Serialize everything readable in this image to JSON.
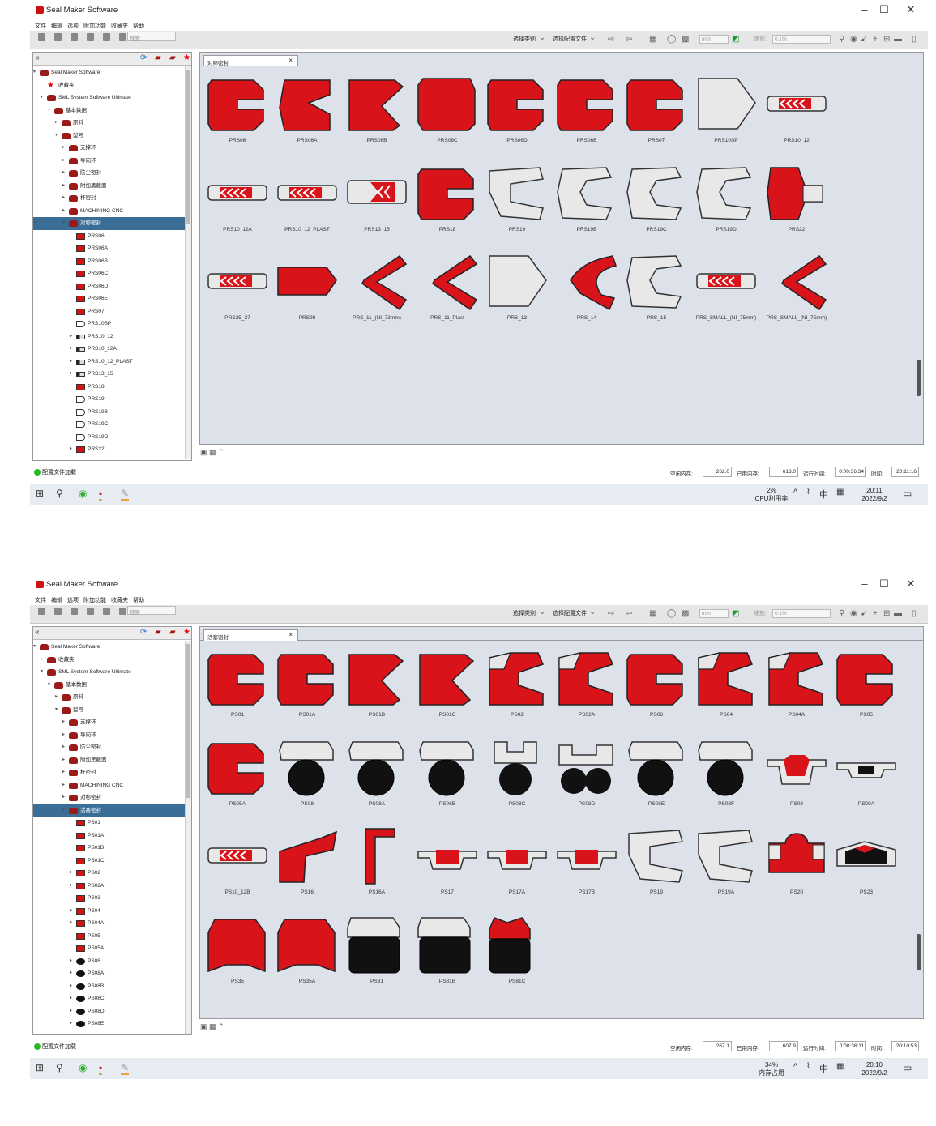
{
  "shots": [
    {
      "window_title": "Seal Maker Software",
      "menu": [
        "文件",
        "编辑",
        "选项",
        "附加功能",
        "收藏夹",
        "帮助"
      ],
      "toolbar": {
        "category_select": "选择类别",
        "config_select": "选择配置文件",
        "unit_value": "mm",
        "zoom_label": "缩放:",
        "zoom_value": "0.1%",
        "search_placeholder": "搜索"
      },
      "tab_label": "对称密封",
      "tree": [
        {
          "label": "Seal Maker Software",
          "level": 0,
          "icon": "folder",
          "exp": "▾"
        },
        {
          "label": "收藏夹",
          "level": 1,
          "icon": "star",
          "exp": ""
        },
        {
          "label": "SML System Software Ultimate",
          "level": 1,
          "icon": "folder",
          "exp": "▾"
        },
        {
          "label": "基本数据",
          "level": 2,
          "icon": "folder",
          "exp": "▾"
        },
        {
          "label": "原料",
          "level": 3,
          "icon": "folder",
          "exp": "▸"
        },
        {
          "label": "型号",
          "level": 3,
          "icon": "folder",
          "exp": "▾"
        },
        {
          "label": "支撑环",
          "level": 4,
          "icon": "folder",
          "exp": "▸"
        },
        {
          "label": "导向环",
          "level": 4,
          "icon": "folder",
          "exp": "▸"
        },
        {
          "label": "防尘密封",
          "level": 4,
          "icon": "folder",
          "exp": "▸"
        },
        {
          "label": "附加黑截面",
          "level": 4,
          "icon": "folder",
          "exp": "▸"
        },
        {
          "label": "杆密封",
          "level": 4,
          "icon": "folder",
          "exp": "▸"
        },
        {
          "label": "MACHINING CNC",
          "level": 4,
          "icon": "folder",
          "exp": "▸"
        },
        {
          "label": "对称密封",
          "level": 4,
          "icon": "folder",
          "exp": "▾",
          "selected": true
        },
        {
          "label": "PRS06",
          "level": 5,
          "icon": "red",
          "exp": ""
        },
        {
          "label": "PRS06A",
          "level": 5,
          "icon": "red",
          "exp": ""
        },
        {
          "label": "PRS06B",
          "level": 5,
          "icon": "red",
          "exp": ""
        },
        {
          "label": "PRS06C",
          "level": 5,
          "icon": "red",
          "exp": ""
        },
        {
          "label": "PRS06D",
          "level": 5,
          "icon": "red",
          "exp": ""
        },
        {
          "label": "PRS06E",
          "level": 5,
          "icon": "red",
          "exp": ""
        },
        {
          "label": "PRS07",
          "level": 5,
          "icon": "red",
          "exp": ""
        },
        {
          "label": "PRS10SP",
          "level": 5,
          "icon": "white",
          "exp": ""
        },
        {
          "label": "PRS10_12",
          "level": 5,
          "icon": "bar",
          "exp": "▸"
        },
        {
          "label": "PRS10_12A",
          "level": 5,
          "icon": "bar",
          "exp": "▸"
        },
        {
          "label": "PRS10_12_PLAST",
          "level": 5,
          "icon": "bar",
          "exp": "▸"
        },
        {
          "label": "PRS13_15",
          "level": 5,
          "icon": "bar",
          "exp": "▸"
        },
        {
          "label": "PRS18",
          "level": 5,
          "icon": "red",
          "exp": ""
        },
        {
          "label": "PRS19",
          "level": 5,
          "icon": "white",
          "exp": ""
        },
        {
          "label": "PRS19B",
          "level": 5,
          "icon": "white",
          "exp": ""
        },
        {
          "label": "PRS19C",
          "level": 5,
          "icon": "white",
          "exp": ""
        },
        {
          "label": "PRS19D",
          "level": 5,
          "icon": "white",
          "exp": ""
        },
        {
          "label": "PRS22",
          "level": 5,
          "icon": "red",
          "exp": "▸"
        },
        {
          "label": "PRS25_27",
          "level": 5,
          "icon": "bar",
          "exp": "▸"
        },
        {
          "label": "PRS99",
          "level": 5,
          "icon": "red",
          "exp": ""
        }
      ],
      "items": [
        {
          "label": "PRS06",
          "shape": "c-red"
        },
        {
          "label": "PRS06A",
          "shape": "c-thin"
        },
        {
          "label": "PRS06B",
          "shape": "k-red"
        },
        {
          "label": "PRS06C",
          "shape": "block-red"
        },
        {
          "label": "PRS06D",
          "shape": "c-red"
        },
        {
          "label": "PRS06E",
          "shape": "c-red"
        },
        {
          "label": "PRS07",
          "shape": "c-red"
        },
        {
          "label": "PRS10SP",
          "shape": "pent-white"
        },
        {
          "label": "PRS10_12",
          "shape": "bar"
        },
        {
          "label": "PRS10_12A",
          "shape": "bar"
        },
        {
          "label": "PRS10_12_PLAST",
          "shape": "bar"
        },
        {
          "label": "PRS13_15",
          "shape": "bar-half"
        },
        {
          "label": "PRS18",
          "shape": "c-red"
        },
        {
          "label": "PRS19",
          "shape": "u-white"
        },
        {
          "label": "PRS19B",
          "shape": "c-white"
        },
        {
          "label": "PRS19C",
          "shape": "c-white"
        },
        {
          "label": "PRS19D",
          "shape": "c-white"
        },
        {
          "label": "PRS22",
          "shape": "red-plug"
        },
        {
          "label": "PRS25_27",
          "shape": "bar"
        },
        {
          "label": "PRS99",
          "shape": "flat-red"
        },
        {
          "label": "PRS_11_(NI_73mm)",
          "shape": "v-red"
        },
        {
          "label": "PRS_11_Plast",
          "shape": "v-red"
        },
        {
          "label": "PRS_13",
          "shape": "pent-white"
        },
        {
          "label": "PRS_14",
          "shape": "horn-red"
        },
        {
          "label": "PRS_15",
          "shape": "c-white"
        },
        {
          "label": "PRS_SMALL_(NI_75mm)",
          "shape": "bar"
        },
        {
          "label": "PRS_SMALL_(NI_75mm)",
          "shape": "v-red"
        }
      ],
      "cols": 9,
      "status": {
        "text": "配置文件加载",
        "free_mem_label": "空闲内存:",
        "free_mem": "262.0",
        "used_mem_label": "已用内存:",
        "used_mem": "613.0",
        "runtime_label": "运行时间:",
        "runtime": "0:00:36:34",
        "time_label": "时间:",
        "time": "20:11:16"
      },
      "taskbar": {
        "perf_value": "2%",
        "perf_label": "CPU利用率",
        "ime": "中",
        "clock_time": "20:11",
        "clock_date": "2022/9/2"
      },
      "tree_thumb_top": 0.0,
      "canvas_thumb_top": 0.78
    },
    {
      "window_title": "Seal Maker Software",
      "menu": [
        "文件",
        "编辑",
        "选项",
        "附加功能",
        "收藏夹",
        "帮助"
      ],
      "toolbar": {
        "category_select": "选择类别",
        "config_select": "选择配置文件",
        "unit_value": "mm",
        "zoom_label": "缩放:",
        "zoom_value": "0.1%",
        "search_placeholder": "搜索"
      },
      "tab_label": "活塞密封",
      "tree": [
        {
          "label": "Seal Maker Software",
          "level": 0,
          "icon": "folder",
          "exp": "▾"
        },
        {
          "label": "收藏夹",
          "level": 1,
          "icon": "folder",
          "exp": "▸"
        },
        {
          "label": "SML System Software Ultimate",
          "level": 1,
          "icon": "folder",
          "exp": "▾"
        },
        {
          "label": "基本数据",
          "level": 2,
          "icon": "folder",
          "exp": "▾"
        },
        {
          "label": "原料",
          "level": 3,
          "icon": "folder",
          "exp": "▸"
        },
        {
          "label": "型号",
          "level": 3,
          "icon": "folder",
          "exp": "▾"
        },
        {
          "label": "支撑环",
          "level": 4,
          "icon": "folder",
          "exp": "▸"
        },
        {
          "label": "导向环",
          "level": 4,
          "icon": "folder",
          "exp": "▸"
        },
        {
          "label": "防尘密封",
          "level": 4,
          "icon": "folder",
          "exp": "▸"
        },
        {
          "label": "附加黑截面",
          "level": 4,
          "icon": "folder",
          "exp": "▸"
        },
        {
          "label": "杆密封",
          "level": 4,
          "icon": "folder",
          "exp": "▸"
        },
        {
          "label": "MACHINING CNC",
          "level": 4,
          "icon": "folder",
          "exp": "▸"
        },
        {
          "label": "对称密封",
          "level": 4,
          "icon": "folder",
          "exp": "▸"
        },
        {
          "label": "活塞密封",
          "level": 4,
          "icon": "folder",
          "exp": "▾",
          "selected": true
        },
        {
          "label": "PS01",
          "level": 5,
          "icon": "red",
          "exp": ""
        },
        {
          "label": "PS01A",
          "level": 5,
          "icon": "red",
          "exp": ""
        },
        {
          "label": "PS01B",
          "level": 5,
          "icon": "red",
          "exp": ""
        },
        {
          "label": "PS01C",
          "level": 5,
          "icon": "red",
          "exp": ""
        },
        {
          "label": "PS02",
          "level": 5,
          "icon": "red",
          "exp": "▸"
        },
        {
          "label": "PS02A",
          "level": 5,
          "icon": "red",
          "exp": "▸"
        },
        {
          "label": "PS03",
          "level": 5,
          "icon": "red",
          "exp": ""
        },
        {
          "label": "PS04",
          "level": 5,
          "icon": "red",
          "exp": "▸"
        },
        {
          "label": "PS04A",
          "level": 5,
          "icon": "red",
          "exp": "▸"
        },
        {
          "label": "PS05",
          "level": 5,
          "icon": "red",
          "exp": ""
        },
        {
          "label": "PS05A",
          "level": 5,
          "icon": "red",
          "exp": ""
        },
        {
          "label": "PS08",
          "level": 5,
          "icon": "black",
          "exp": "▸"
        },
        {
          "label": "PS08A",
          "level": 5,
          "icon": "black",
          "exp": "▸"
        },
        {
          "label": "PS08B",
          "level": 5,
          "icon": "black",
          "exp": "▸"
        },
        {
          "label": "PS08C",
          "level": 5,
          "icon": "black",
          "exp": "▸"
        },
        {
          "label": "PS08D",
          "level": 5,
          "icon": "black",
          "exp": "▸"
        },
        {
          "label": "PS08E",
          "level": 5,
          "icon": "black",
          "exp": "▸"
        },
        {
          "label": "PS08F",
          "level": 5,
          "icon": "black",
          "exp": "▸"
        },
        {
          "label": "PS09",
          "level": 5,
          "icon": "black",
          "exp": "▸"
        }
      ],
      "items": [
        {
          "label": "PS01",
          "shape": "c-red"
        },
        {
          "label": "PS01A",
          "shape": "c-red"
        },
        {
          "label": "PS01B",
          "shape": "k-red"
        },
        {
          "label": "PS01C",
          "shape": "k-red"
        },
        {
          "label": "PS02",
          "shape": "c-red-cap"
        },
        {
          "label": "PS02A",
          "shape": "c-red-cap"
        },
        {
          "label": "PS03",
          "shape": "c-red"
        },
        {
          "label": "PS04",
          "shape": "c-red-cap"
        },
        {
          "label": "PS04A",
          "shape": "c-red-cap"
        },
        {
          "label": "PS05",
          "shape": "c-red"
        },
        {
          "label": "PS05A",
          "shape": "c-red"
        },
        {
          "label": "PS08",
          "shape": "cap-oring"
        },
        {
          "label": "PS08A",
          "shape": "cap-oring"
        },
        {
          "label": "PS08B",
          "shape": "cap-oring"
        },
        {
          "label": "PS08C",
          "shape": "u-oring"
        },
        {
          "label": "PS08D",
          "shape": "two-oring"
        },
        {
          "label": "PS08E",
          "shape": "cap-oring"
        },
        {
          "label": "PS08F",
          "shape": "cap-oring"
        },
        {
          "label": "PS09",
          "shape": "t-red"
        },
        {
          "label": "PS09A",
          "shape": "t-small"
        },
        {
          "label": "PS10_12B",
          "shape": "bar"
        },
        {
          "label": "PS16",
          "shape": "l-red"
        },
        {
          "label": "PS16A",
          "shape": "l-thin"
        },
        {
          "label": "PS17",
          "shape": "t-flat"
        },
        {
          "label": "PS17A",
          "shape": "t-flat"
        },
        {
          "label": "PS17B",
          "shape": "t-flat"
        },
        {
          "label": "PS19",
          "shape": "u-white"
        },
        {
          "label": "PS19A",
          "shape": "u-white"
        },
        {
          "label": "PS20",
          "shape": "dome-red"
        },
        {
          "label": "PS23",
          "shape": "flat-black"
        },
        {
          "label": "PS35",
          "shape": "round-red"
        },
        {
          "label": "PS35A",
          "shape": "round-red"
        },
        {
          "label": "PS81",
          "shape": "cap-black"
        },
        {
          "label": "PS81B",
          "shape": "cap-black"
        },
        {
          "label": "PS81C",
          "shape": "redcap-black"
        }
      ],
      "cols": 10,
      "status": {
        "text": "配置文件加载",
        "free_mem_label": "空闲内存:",
        "free_mem": "267.1",
        "used_mem_label": "已用内存:",
        "used_mem": "607.9",
        "runtime_label": "运行时间:",
        "runtime": "0:00:36:11",
        "time_label": "时间:",
        "time": "20:10:53"
      },
      "taskbar": {
        "perf_value": "34%",
        "perf_label": "内存占用",
        "ime": "中",
        "clock_time": "20:10",
        "clock_date": "2022/9/2"
      },
      "tree_thumb_top": 0.0,
      "canvas_thumb_top": 0.78
    }
  ]
}
